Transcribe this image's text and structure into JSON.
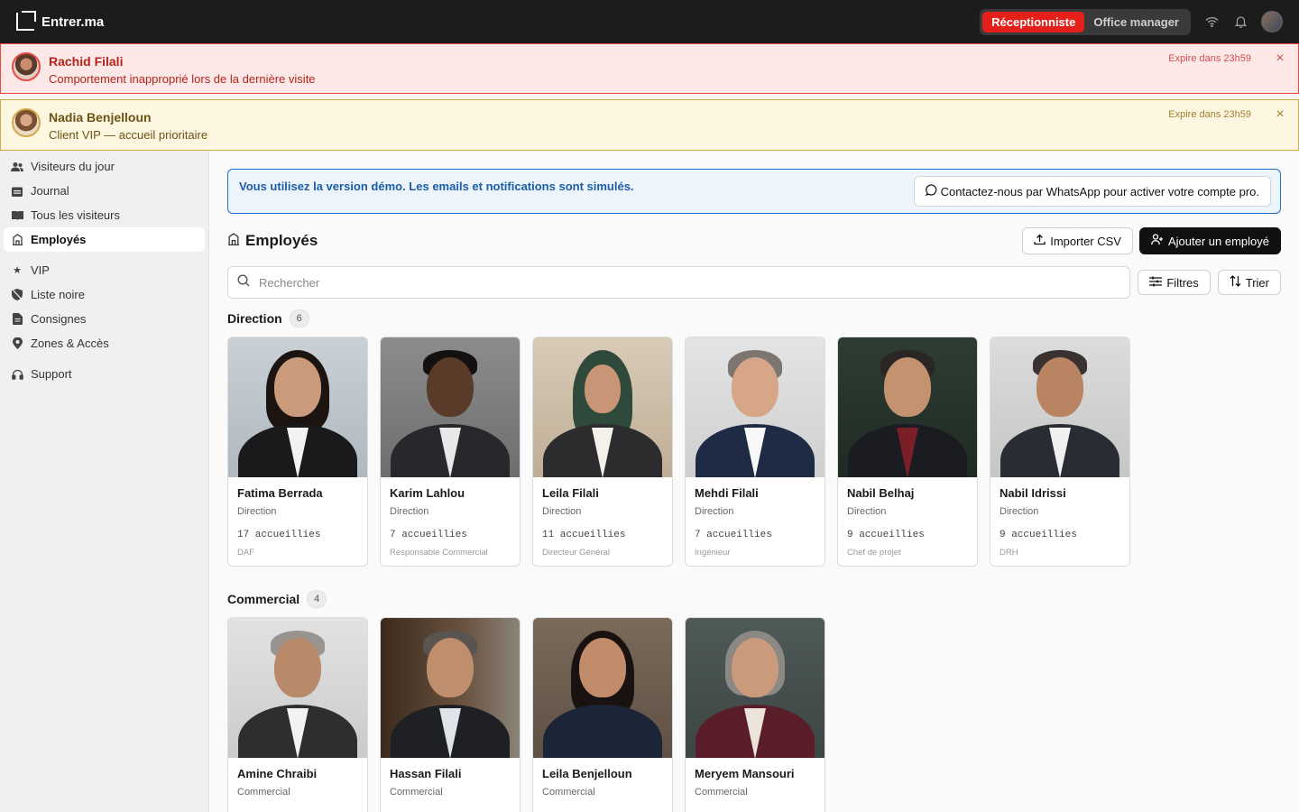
{
  "app": {
    "name": "Entrer.ma"
  },
  "topbar": {
    "roles": [
      "Réceptionniste",
      "Office manager"
    ],
    "active_role": "Réceptionniste"
  },
  "alerts": [
    {
      "name": "Rachid Filali",
      "message": "Comportement inapproprié lors de la dernière visite",
      "expire": "Expire dans 23h59",
      "type": "blacklist",
      "color": "#e84a4a"
    },
    {
      "name": "Nadia Benjelloun",
      "message": "Client VIP — accueil prioritaire",
      "expire": "Expire dans 23h59",
      "type": "vip",
      "color": "#d4a94a"
    }
  ],
  "sidebar": {
    "items": [
      {
        "label": "Visiteurs du jour",
        "icon": "users-icon"
      },
      {
        "label": "Journal",
        "icon": "calendar-icon"
      },
      {
        "label": "Tous les visiteurs",
        "icon": "book-icon"
      },
      {
        "label": "Employés",
        "icon": "building-icon",
        "active": true
      },
      {
        "label": "VIP",
        "icon": "star-icon"
      },
      {
        "label": "Liste noire",
        "icon": "shield-off-icon"
      },
      {
        "label": "Consignes",
        "icon": "file-icon"
      },
      {
        "label": "Zones & Accès",
        "icon": "map-pin-icon"
      },
      {
        "label": "Support",
        "icon": "headphones-icon"
      }
    ]
  },
  "demo": {
    "message": "Vous utilisez la version démo. Les emails et notifications sont simulés.",
    "cta": "Contactez-nous par WhatsApp pour activer votre compte pro."
  },
  "page": {
    "title": "Employés",
    "import_label": "Importer CSV",
    "add_label": "Ajouter un employé"
  },
  "search": {
    "placeholder": "Rechercher",
    "value": ""
  },
  "toolbar": {
    "filters_label": "Filtres",
    "sort_label": "Trier"
  },
  "groups": [
    {
      "name": "Direction",
      "count": "6",
      "employees": [
        {
          "name": "Fatima Berrada",
          "dept": "Direction",
          "stat": "17 accueillies",
          "role": "DAF"
        },
        {
          "name": "Karim Lahlou",
          "dept": "Direction",
          "stat": "7 accueillies",
          "role": "Responsable Commercial"
        },
        {
          "name": "Leila Filali",
          "dept": "Direction",
          "stat": "11 accueillies",
          "role": "Directeur Général"
        },
        {
          "name": "Mehdi Filali",
          "dept": "Direction",
          "stat": "7 accueillies",
          "role": "Ingénieur"
        },
        {
          "name": "Nabil Belhaj",
          "dept": "Direction",
          "stat": "9 accueillies",
          "role": "Chef de projet"
        },
        {
          "name": "Nabil Idrissi",
          "dept": "Direction",
          "stat": "9 accueillies",
          "role": "DRH"
        }
      ]
    },
    {
      "name": "Commercial",
      "count": "4",
      "employees": [
        {
          "name": "Amine Chraibi",
          "dept": "Commercial"
        },
        {
          "name": "Hassan Filali",
          "dept": "Commercial"
        },
        {
          "name": "Leila Benjelloun",
          "dept": "Commercial"
        },
        {
          "name": "Meryem Mansouri",
          "dept": "Commercial"
        }
      ]
    }
  ]
}
